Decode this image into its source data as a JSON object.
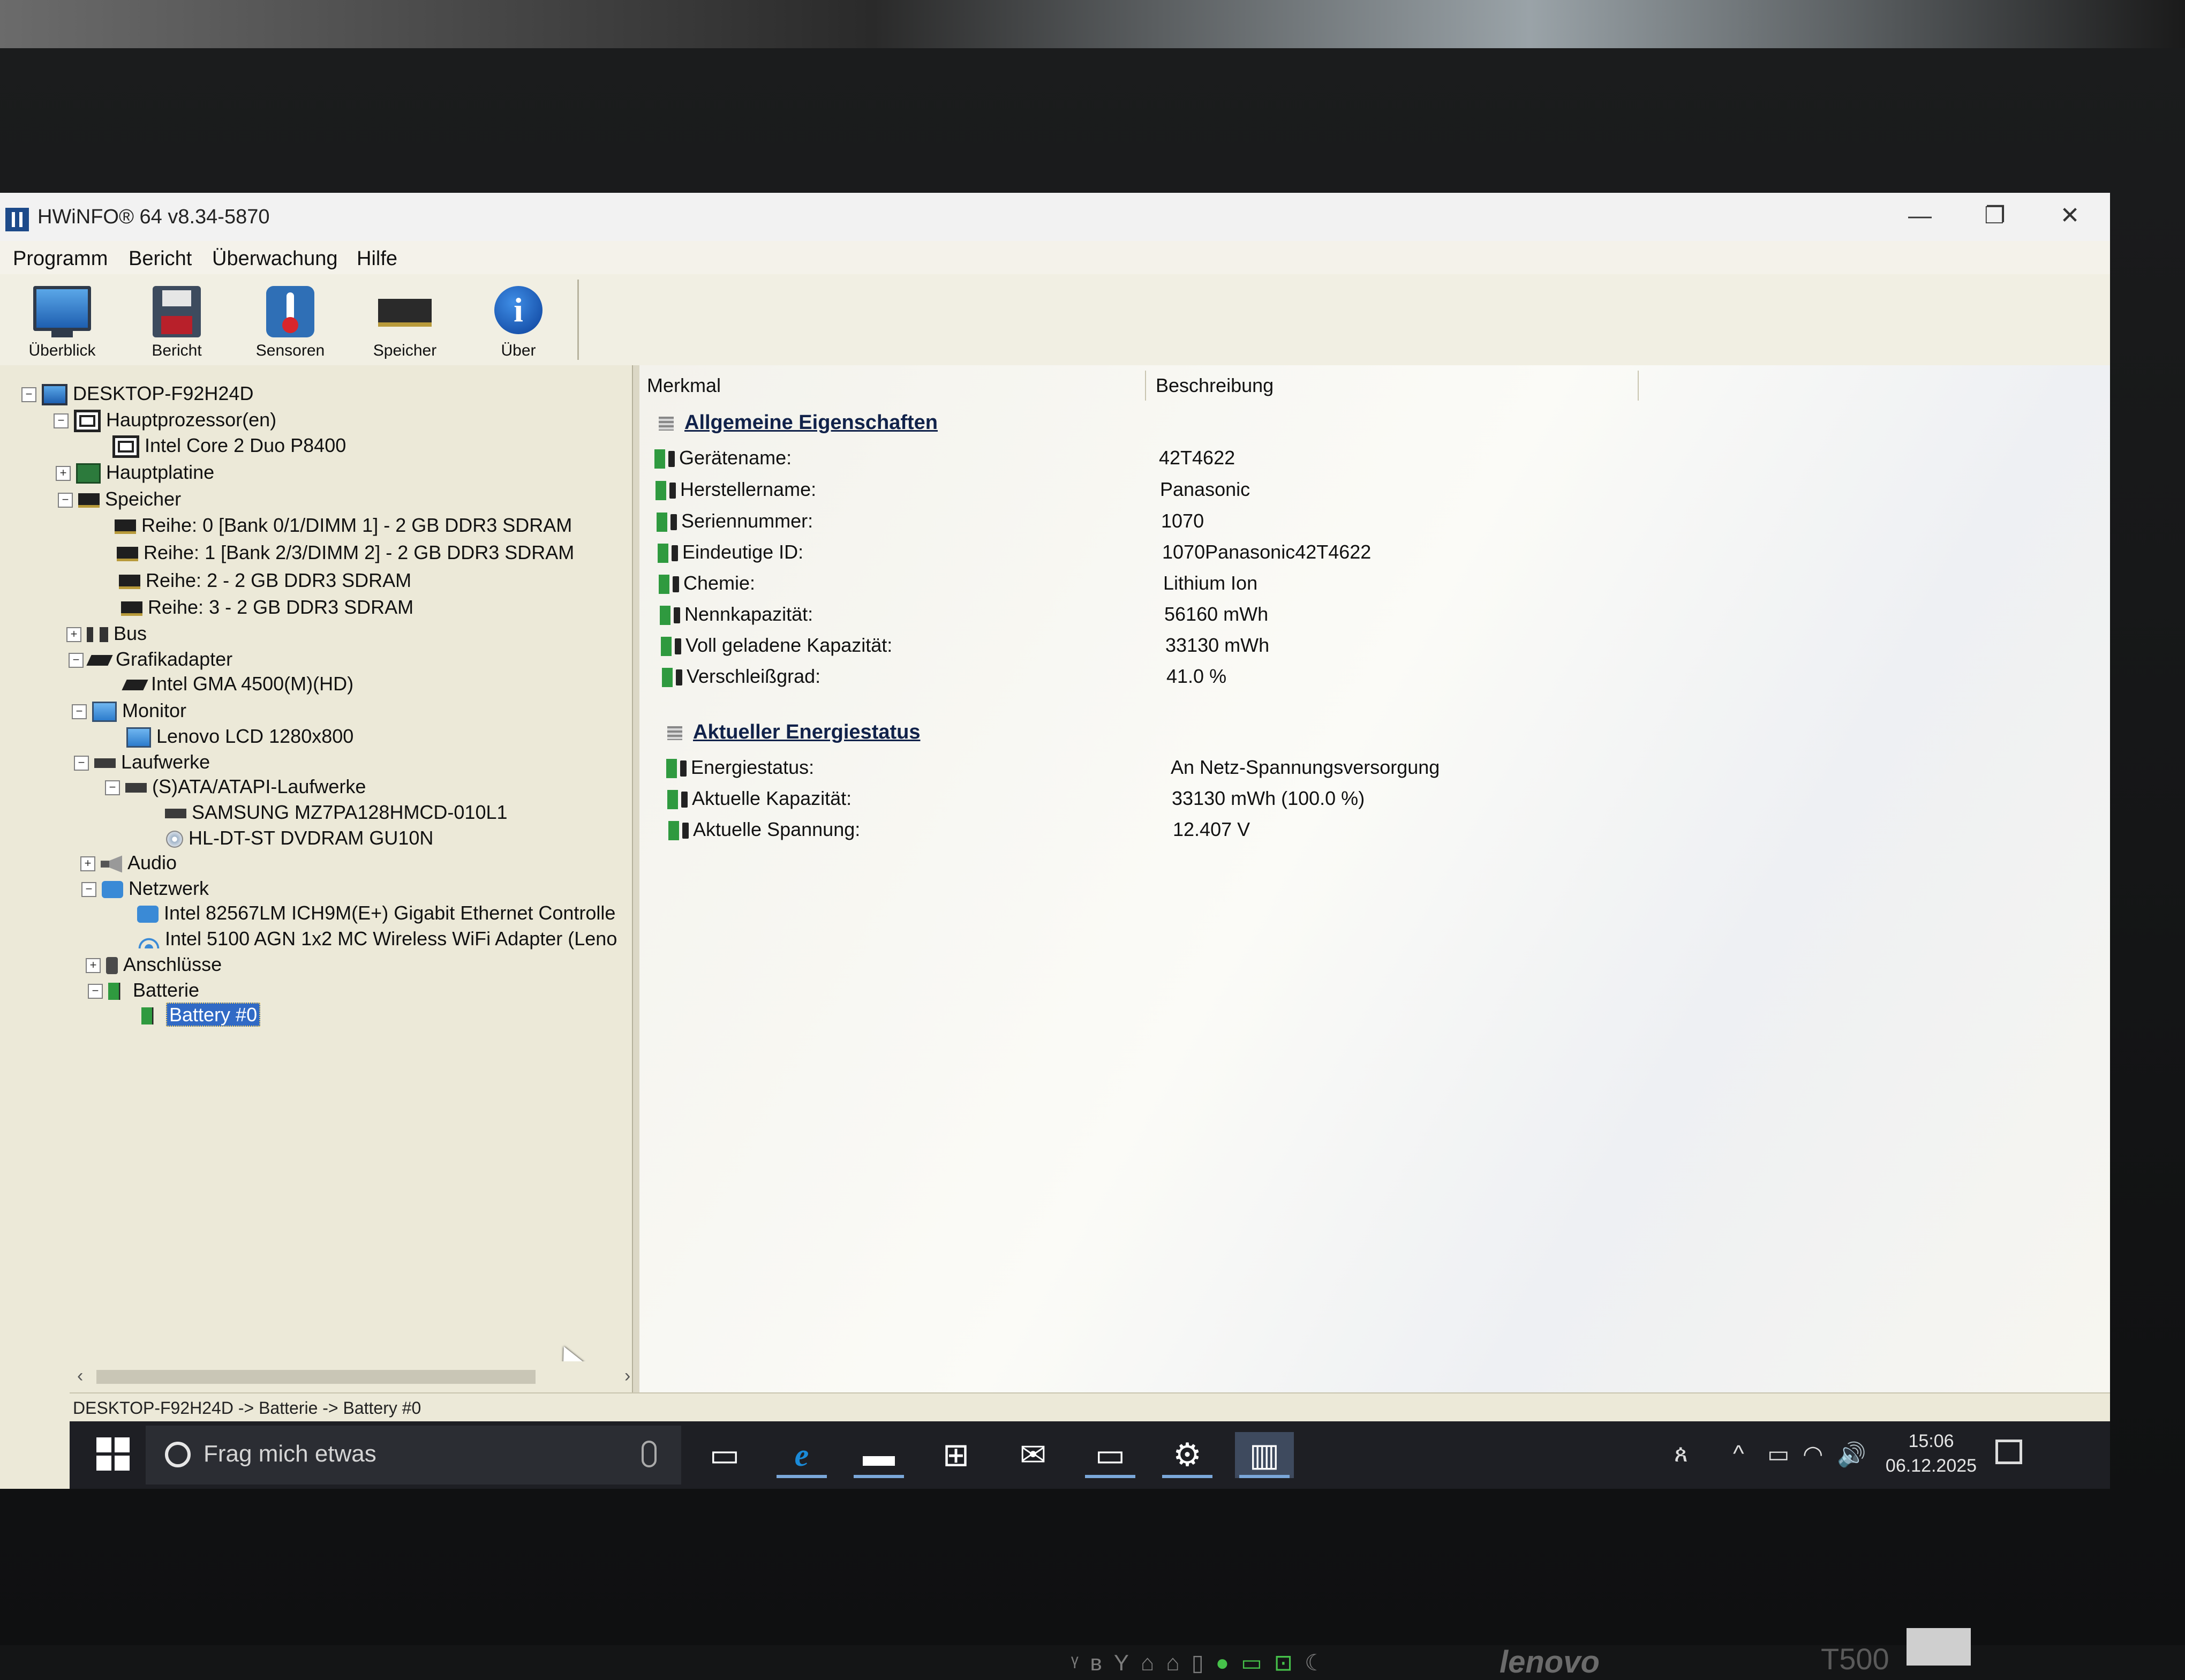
{
  "window": {
    "title": "HWiNFO® 64 v8.34-5870",
    "minimize": "—",
    "restore": "❐",
    "close": "✕"
  },
  "menu": [
    "Programm",
    "Bericht",
    "Überwachung",
    "Hilfe"
  ],
  "toolbar": {
    "overview": "Überblick",
    "report": "Bericht",
    "sensors": "Sensoren",
    "memory": "Speicher",
    "about": "Über"
  },
  "tree": {
    "root": "DESKTOP-F92H24D",
    "cpu_group": "Hauptprozessor(en)",
    "cpu": "Intel Core 2 Duo P8400",
    "board": "Hauptplatine",
    "memory": "Speicher",
    "ram0": "Reihe: 0 [Bank 0/1/DIMM 1] - 2 GB DDR3 SDRAM",
    "ram1": "Reihe: 1 [Bank 2/3/DIMM 2] - 2 GB DDR3 SDRAM",
    "ram2": "Reihe: 2 - 2 GB DDR3 SDRAM",
    "ram3": "Reihe: 3 - 2 GB DDR3 SDRAM",
    "bus": "Bus",
    "gpu_group": "Grafikadapter",
    "gpu": "Intel GMA 4500(M)(HD)",
    "monitor_group": "Monitor",
    "monitor": "Lenovo LCD 1280x800",
    "drives": "Laufwerke",
    "ata": "(S)ATA/ATAPI-Laufwerke",
    "ssd": "SAMSUNG MZ7PA128HMCD-010L1",
    "dvd": "HL-DT-ST DVDRAM GU10N",
    "audio": "Audio",
    "network": "Netzwerk",
    "eth": "Intel 82567LM ICH9M(E+) Gigabit Ethernet Controlle",
    "wifi": "Intel 5100 AGN 1x2 MC Wireless WiFi Adapter (Leno",
    "ports": "Anschlüsse",
    "battery_group": "Batterie",
    "battery": "Battery #0"
  },
  "detail": {
    "col_feature": "Merkmal",
    "col_description": "Beschreibung",
    "section1": "Allgemeine Eigenschaften",
    "section1_rows": [
      {
        "name": "Gerätename:",
        "value": "42T4622"
      },
      {
        "name": "Herstellername:",
        "value": "Panasonic"
      },
      {
        "name": "Seriennummer:",
        "value": " 1070"
      },
      {
        "name": "Eindeutige ID:",
        "value": " 1070Panasonic42T4622"
      },
      {
        "name": "Chemie:",
        "value": "Lithium Ion"
      },
      {
        "name": "Nennkapazität:",
        "value": "56160 mWh"
      },
      {
        "name": "Voll geladene Kapazität:",
        "value": "33130 mWh"
      },
      {
        "name": "Verschleißgrad:",
        "value": "41.0 %"
      }
    ],
    "section2": "Aktueller Energiestatus",
    "section2_rows": [
      {
        "name": "Energiestatus:",
        "value": "An Netz-Spannungsversorgung"
      },
      {
        "name": "Aktuelle Kapazität:",
        "value": "33130 mWh (100.0 %)"
      },
      {
        "name": "Aktuelle Spannung:",
        "value": "12.407 V"
      }
    ]
  },
  "statusbar": "DESKTOP-F92H24D -> Batterie -> Battery #0",
  "taskbar": {
    "search_placeholder": "Frag mich etwas",
    "time": "15:06",
    "date": "06.12.2025"
  },
  "laptop": {
    "brand": "lenovo",
    "model": "T500"
  }
}
